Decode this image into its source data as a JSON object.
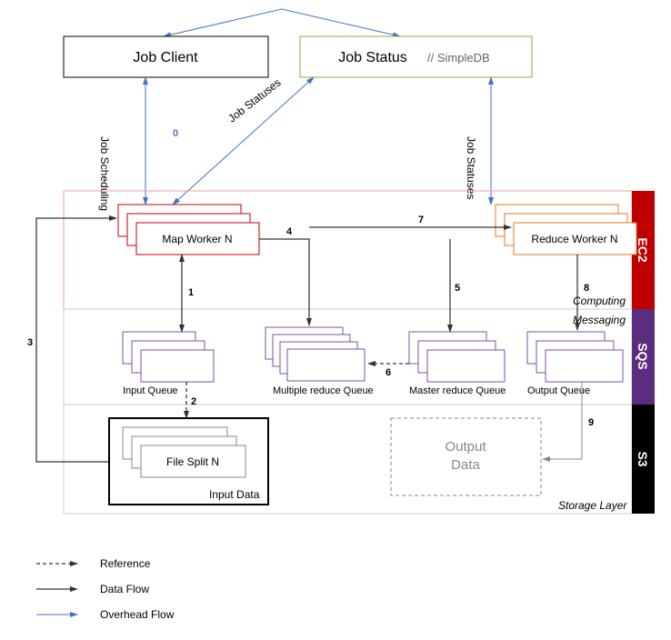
{
  "top": {
    "jobClient": "Job Client",
    "jobStatus": "Job Status",
    "simpleDb": "// SimpleDB"
  },
  "labels": {
    "jobScheduling": "Job Scheduling",
    "jobStatuses1": "Job Statuses",
    "jobStatuses2": "Job Statuses",
    "mapWorker": "Map Worker N",
    "reduceWorker": "Reduce Worker N",
    "inputQueue": "Input Queue",
    "multiReduce": "Multiple reduce Queue",
    "masterReduce": "Master reduce Queue",
    "outputQueue": "Output Queue",
    "fileSplit": "File Split N",
    "inputData": "Input Data",
    "outputData1": "Output",
    "outputData2": "Data"
  },
  "layers": {
    "ec2": "EC2",
    "sqs": "SQS",
    "s3": "S3",
    "computing": "Computing",
    "messaging": "Messaging",
    "storage": "Storage Layer"
  },
  "steps": {
    "s0": "0",
    "s1": "1",
    "s2": "2",
    "s3": "3",
    "s4": "4",
    "s5": "5",
    "s6": "6",
    "s7": "7",
    "s8": "8",
    "s9": "9"
  },
  "legend": {
    "reference": "Reference",
    "dataFlow": "Data Flow",
    "overheadFlow": "Overhead Flow"
  }
}
